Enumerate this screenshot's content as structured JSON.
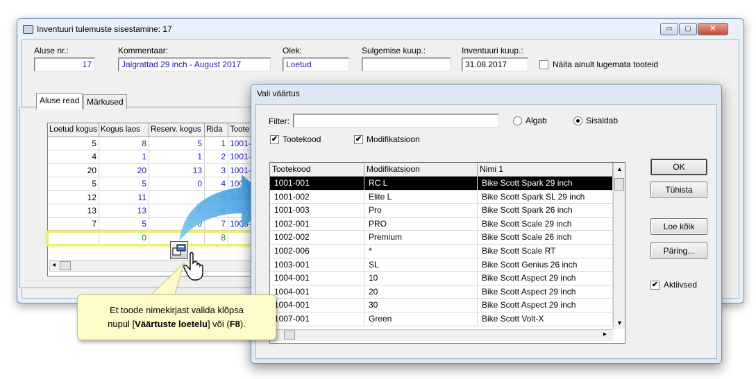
{
  "main_window": {
    "title": "Inventuuri tulemuste sisestamine: 17",
    "buttons": {
      "minimize": "▭",
      "maximize": "▢",
      "close": "✕"
    },
    "fields": {
      "aluse_nr_label": "Aluse nr.:",
      "aluse_nr_value": "17",
      "kommentaar_label": "Kommentaar:",
      "kommentaar_value": "Jalgrattad 29 inch - August 2017",
      "olek_label": "Olek:",
      "olek_value": "Loetud",
      "sulgemise_label": "Sulgemise kuup.:",
      "sulgemise_value": "",
      "inventuuri_label": "Inventuuri kuup.:",
      "inventuuri_value": "31.08.2017",
      "naita_label": "Näita ainult lugemata tooteid"
    },
    "tabs": [
      "Aluse read",
      "Märkused"
    ],
    "grid": {
      "columns": [
        "Loetud kogus",
        "Kogus laos",
        "Reserv. kogus",
        "Rida",
        "Toote"
      ],
      "rows": [
        [
          "5",
          "8",
          "5",
          "1",
          "1001-"
        ],
        [
          "4",
          "1",
          "1",
          "2",
          "1001-"
        ],
        [
          "20",
          "20",
          "13",
          "3",
          "1001-"
        ],
        [
          "5",
          "5",
          "0",
          "4",
          "1001-"
        ],
        [
          "12",
          "11",
          "",
          "5",
          "1001-"
        ],
        [
          "13",
          "13",
          "3",
          "6",
          "1002-"
        ],
        [
          "7",
          "5",
          "0",
          "7",
          "1008-"
        ],
        [
          "",
          "0",
          "",
          "8",
          ""
        ]
      ]
    }
  },
  "dialog": {
    "title": "Vali väärtus",
    "filter_label": "Filter:",
    "filter_value": "",
    "radio_algab": "Algab",
    "radio_sisaldab": "Sisaldab",
    "check_tootekood": "Tootekood",
    "check_modifikatsioon": "Modifikatsioon",
    "columns": [
      "Tootekood",
      "Modifikatsioon",
      "Nimi 1"
    ],
    "rows": [
      [
        "1001-001",
        "RC L",
        "Bike Scott Spark 29 inch"
      ],
      [
        "1001-002",
        "Elite L",
        "Bike Scott Spark SL 29 inch"
      ],
      [
        "1001-003",
        "Pro",
        "Bike Scott Spark 26 inch"
      ],
      [
        "1002-001",
        "PRO",
        "Bike Scott Scale 29 inch"
      ],
      [
        "1002-002",
        "Premium",
        "Bike Scott Scale 26 inch"
      ],
      [
        "1002-006",
        "*",
        "Bike Scott Scale RT"
      ],
      [
        "1003-001",
        "SL",
        "Bike Scott Genius 26 inch"
      ],
      [
        "1004-001",
        "10",
        "Bike Scott Aspect 29 inch"
      ],
      [
        "1004-001",
        "20",
        "Bike Scott Aspect 29 inch"
      ],
      [
        "1004-001",
        "30",
        "Bike Scott Aspect 29 inch"
      ],
      [
        "1007-001",
        "Green",
        "Bike Scott Volt-X"
      ]
    ],
    "buttons": {
      "ok": "OK",
      "tuhista": "Tühista",
      "loe_koik": "Loe kõik",
      "paring": "Päring..."
    },
    "aktiivsed_label": "Aktiivsed"
  },
  "callout": {
    "line1": "Et toode nimekirjast valida klõpsa",
    "line2_prefix": "nupul [",
    "line2_bold1": "Väärtuste loetelu",
    "line2_mid": "] või (",
    "line2_bold2": "F8",
    "line2_suffix": ")."
  }
}
